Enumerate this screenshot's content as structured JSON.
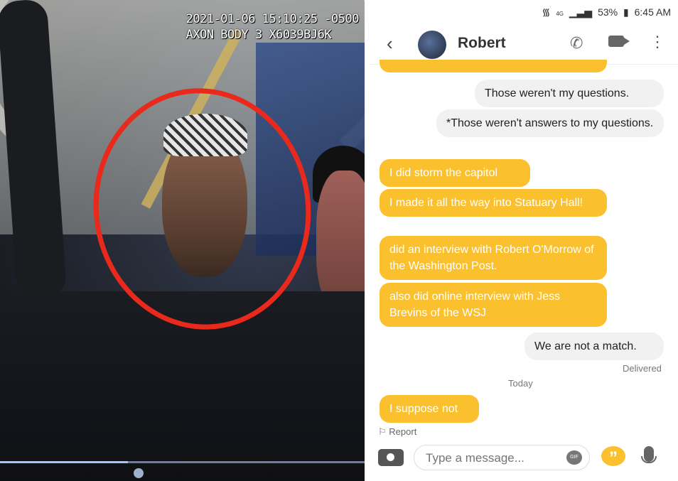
{
  "photo": {
    "timestamp": "2021-01-06 15:10:25 -0500",
    "camera_id": "AXON BODY 3 X6039BJ6K"
  },
  "status": {
    "network": "4G",
    "battery": "53%",
    "time": "6:45 AM"
  },
  "chat": {
    "contact_name": "Robert",
    "messages": [
      {
        "sender": "me",
        "text": "Those weren't my questions."
      },
      {
        "sender": "me",
        "text": "*Those weren't answers to my questions."
      },
      {
        "sender": "them",
        "text": "I did storm the capitol"
      },
      {
        "sender": "them",
        "text": "I made it all the way into Statuary Hall!"
      },
      {
        "sender": "them",
        "text": "did an interview with Robert O'Morrow of the Washington Post."
      },
      {
        "sender": "them",
        "text": "also did online interview with Jess Brevins of the WSJ"
      },
      {
        "sender": "me",
        "text": "We are not a match."
      },
      {
        "sender": "them",
        "text": "I suppose not"
      }
    ],
    "delivered_label": "Delivered",
    "day_label": "Today",
    "report_label": "Report",
    "composer_placeholder": "Type a message...",
    "gif_label": "GIF"
  },
  "colors": {
    "accent": "#fbc02d",
    "circle": "#e8291c"
  }
}
